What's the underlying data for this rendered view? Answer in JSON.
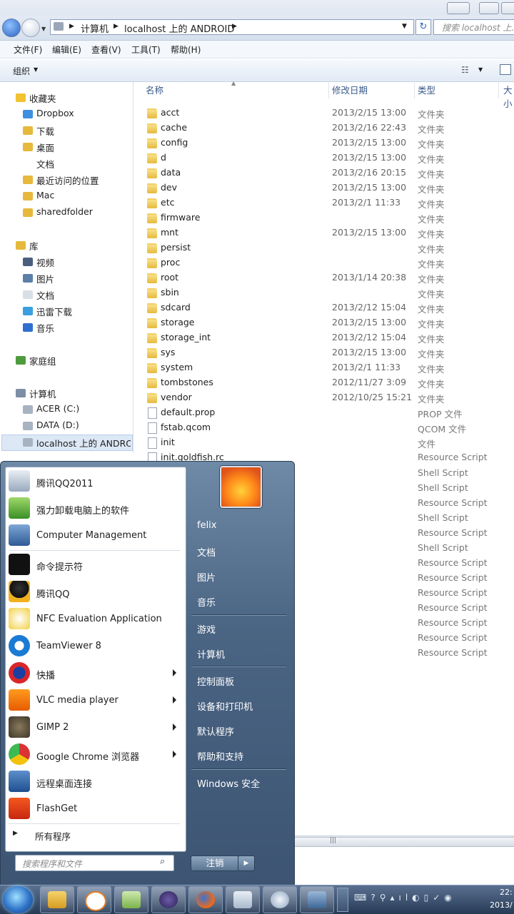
{
  "address": {
    "parts": [
      "计算机",
      "localhost 上的 ANDROID"
    ],
    "search_placeholder": "搜索 localhost 上..."
  },
  "menubar": [
    "文件(F)",
    "编辑(E)",
    "查看(V)",
    "工具(T)",
    "帮助(H)"
  ],
  "toolbar": {
    "organize": "组织"
  },
  "nav": {
    "favorites": "收藏夹",
    "fav_items": [
      "Dropbox",
      "下载",
      "桌面",
      "文档",
      "最近访问的位置",
      "Mac",
      "sharedfolder"
    ],
    "libraries": "库",
    "lib_items": [
      "视频",
      "图片",
      "文档",
      "迅雷下载",
      "音乐"
    ],
    "homegroup": "家庭组",
    "computer": "计算机",
    "comp_items": [
      "ACER (C:)",
      "DATA (D:)",
      "localhost 上的 ANDROID"
    ]
  },
  "columns": {
    "name": "名称",
    "date": "修改日期",
    "type": "类型",
    "size": "大小"
  },
  "files": [
    {
      "name": "acct",
      "date": "2013/2/15 13:00",
      "type": "文件夹"
    },
    {
      "name": "cache",
      "date": "2013/2/16 22:43",
      "type": "文件夹"
    },
    {
      "name": "config",
      "date": "2013/2/15 13:00",
      "type": "文件夹"
    },
    {
      "name": "d",
      "date": "2013/2/15 13:00",
      "type": "文件夹"
    },
    {
      "name": "data",
      "date": "2013/2/16 20:15",
      "type": "文件夹"
    },
    {
      "name": "dev",
      "date": "2013/2/15 13:00",
      "type": "文件夹"
    },
    {
      "name": "etc",
      "date": "2013/2/1 11:33",
      "type": "文件夹"
    },
    {
      "name": "firmware",
      "date": "",
      "type": "文件夹"
    },
    {
      "name": "mnt",
      "date": "2013/2/15 13:00",
      "type": "文件夹"
    },
    {
      "name": "persist",
      "date": "",
      "type": "文件夹"
    },
    {
      "name": "proc",
      "date": "",
      "type": "文件夹"
    },
    {
      "name": "root",
      "date": "2013/1/14 20:38",
      "type": "文件夹"
    },
    {
      "name": "sbin",
      "date": "",
      "type": "文件夹"
    },
    {
      "name": "sdcard",
      "date": "2013/2/12 15:04",
      "type": "文件夹"
    },
    {
      "name": "storage",
      "date": "2013/2/15 13:00",
      "type": "文件夹"
    },
    {
      "name": "storage_int",
      "date": "2013/2/12 15:04",
      "type": "文件夹"
    },
    {
      "name": "sys",
      "date": "2013/2/15 13:00",
      "type": "文件夹"
    },
    {
      "name": "system",
      "date": "2013/2/1 11:33",
      "type": "文件夹"
    },
    {
      "name": "tombstones",
      "date": "2012/11/27 3:09",
      "type": "文件夹"
    },
    {
      "name": "vendor",
      "date": "2012/10/25 15:21",
      "type": "文件夹"
    },
    {
      "name": "default.prop",
      "date": "",
      "type": "PROP 文件"
    },
    {
      "name": "fstab.qcom",
      "date": "",
      "type": "QCOM 文件"
    },
    {
      "name": "init",
      "date": "",
      "type": "文件"
    },
    {
      "name": "init.goldfish.rc",
      "date": "",
      "type": "Resource Script"
    }
  ],
  "hidden_types": [
    "Shell Script",
    "Shell Script",
    "Resource Script",
    "Shell Script",
    "Resource Script",
    "Shell Script",
    "Resource Script",
    "Resource Script",
    "Resource Script",
    "Resource Script",
    "Resource Script",
    "Resource Script",
    "Resource Script"
  ],
  "start": {
    "programs": [
      {
        "label": "腾讯QQ2011",
        "arrow": false
      },
      {
        "label": "强力卸载电脑上的软件",
        "arrow": false
      },
      {
        "label": "Computer Management",
        "arrow": false
      },
      {
        "label": "命令提示符",
        "arrow": false
      },
      {
        "label": "腾讯QQ",
        "arrow": false
      },
      {
        "label": "NFC Evaluation Application",
        "arrow": false
      },
      {
        "label": "TeamViewer 8",
        "arrow": false
      },
      {
        "label": "快播",
        "arrow": true
      },
      {
        "label": "VLC media player",
        "arrow": true
      },
      {
        "label": "GIMP 2",
        "arrow": true
      },
      {
        "label": "Google Chrome 浏览器",
        "arrow": true
      },
      {
        "label": "远程桌面连接",
        "arrow": false
      },
      {
        "label": "FlashGet",
        "arrow": false
      }
    ],
    "all_programs": "所有程序",
    "search_placeholder": "搜索程序和文件",
    "right": [
      "felix",
      "文档",
      "图片",
      "音乐",
      "游戏",
      "计算机",
      "控制面板",
      "设备和打印机",
      "默认程序",
      "帮助和支持",
      "Windows 安全"
    ],
    "shutdown": "注销"
  },
  "clock": {
    "time": "22:",
    "date": "2013/"
  },
  "colors": {
    "accent": "#3b6fb6",
    "folder": "#e6b93c"
  }
}
